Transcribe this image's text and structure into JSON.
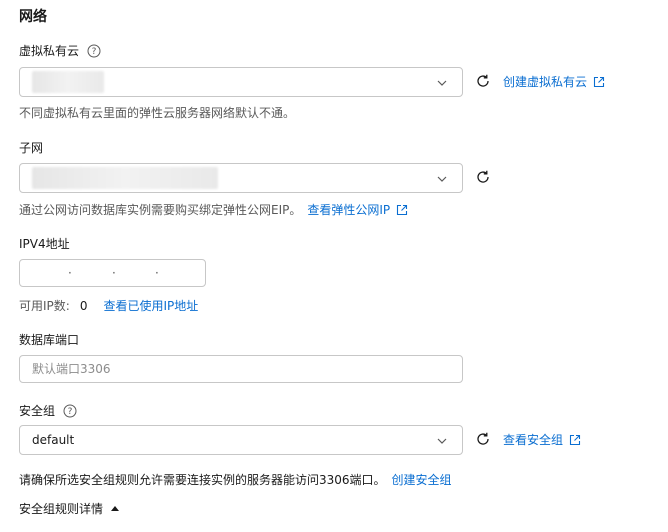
{
  "section": {
    "title": "网络"
  },
  "vpc": {
    "label": "虚拟私有云",
    "create_link": "创建虚拟私有云",
    "hint": "不同虚拟私有云里面的弹性云服务器网络默认不通。"
  },
  "subnet": {
    "label": "子网",
    "hint": "通过公网访问数据库实例需要购买绑定弹性公网EIP。",
    "hint_link": "查看弹性公网IP"
  },
  "ipv4": {
    "label": "IPV4地址",
    "available_label": "可用IP数:",
    "available_count": "0",
    "used_link": "查看已使用IP地址"
  },
  "port": {
    "label": "数据库端口",
    "placeholder": "默认端口3306"
  },
  "security_group": {
    "label": "安全组",
    "value": "default",
    "view_link": "查看安全组",
    "hint": "请确保所选安全组规则允许需要连接实例的服务器能访问3306端口。",
    "create_link": "创建安全组",
    "details_toggle": "安全组规则详情"
  },
  "icons": {
    "help": "question-circle-icon",
    "chevron": "chevron-down-icon",
    "refresh": "refresh-icon",
    "external": "external-link-icon",
    "caret": "caret-up-icon"
  },
  "colors": {
    "link": "#0a6ed1",
    "border": "#c7c7c7",
    "hint": "#595959"
  }
}
